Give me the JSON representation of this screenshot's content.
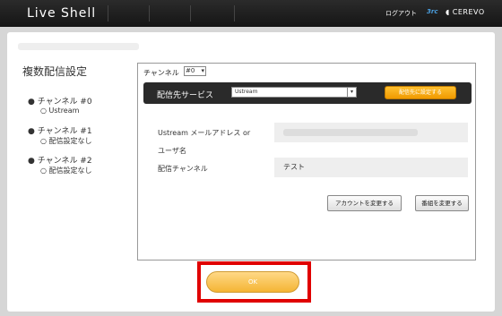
{
  "header": {
    "logo": "Live Shell",
    "nav": [
      "",
      "",
      ""
    ],
    "logout": "ログアウト",
    "brand_3c": "3rc",
    "cerevo": "CEREVO"
  },
  "sidebar": {
    "title": "複数配信設定",
    "channels": [
      {
        "label": "チャンネル #0",
        "sub": "Ustream"
      },
      {
        "label": "チャンネル #1",
        "sub": "配信設定なし"
      },
      {
        "label": "チャンネル #2",
        "sub": "配信設定なし"
      }
    ]
  },
  "config": {
    "channel_label": "チャンネル",
    "channel_value": "#0",
    "service_label": "配信先サービス",
    "service_value": "Ustream",
    "set_button": "配信先に設定する",
    "fields": [
      {
        "label": "Ustream メールアドレス or",
        "label2": "ユーザ名",
        "value": ""
      },
      {
        "label": "配信チャンネル",
        "value": "テスト"
      }
    ],
    "change_account": "アカウントを変更する",
    "change_channel": "番組を変更する"
  },
  "ok": {
    "label": "OK"
  },
  "colors": {
    "accent": "#f3a912",
    "highlight": "#e00000",
    "topbar": "#1e1e1e"
  }
}
